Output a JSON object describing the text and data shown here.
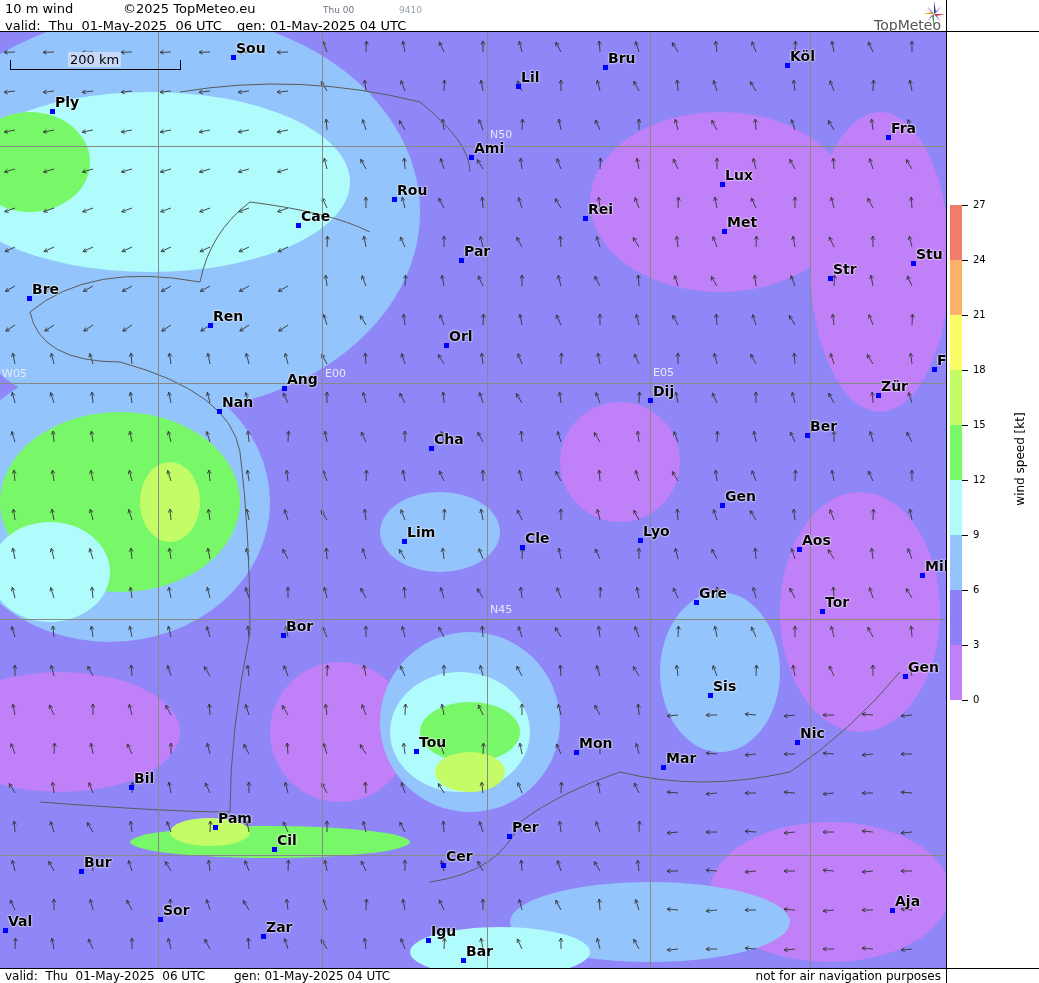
{
  "header": {
    "title": "10 m wind",
    "copyright": "©2025 TopMeteo.eu",
    "run_label": "Thu 00",
    "code": "9410",
    "valid": "valid:  Thu  01-May-2025  06 UTC",
    "generated": "gen: 01-May-2025 04 UTC",
    "logo": "TopMeteo"
  },
  "map": {
    "scale_bar": "200 km",
    "grid_labels": [
      "N50",
      "W05",
      "E00",
      "E05",
      "N45"
    ],
    "cities": [
      "Sou",
      "Ply",
      "Lil",
      "Bru",
      "Köl",
      "Ami",
      "Fra",
      "Lux",
      "Rou",
      "Cae",
      "Rei",
      "Met",
      "Par",
      "Stu",
      "Str",
      "Bre",
      "Ren",
      "Orl",
      "F",
      "Ang",
      "Nan",
      "Dij",
      "Zür",
      "Ber",
      "Cha",
      "Gen",
      "Lim",
      "Cle",
      "Lyo",
      "Aos",
      "Mil",
      "Gre",
      "Tor",
      "Bor",
      "Gen",
      "Sis",
      "Nic",
      "Tou",
      "Mon",
      "Mar",
      "Bil",
      "Per",
      "Pam",
      "Cil",
      "Cer",
      "Bur",
      "Aja",
      "Sor",
      "Val",
      "Zar",
      "Igu",
      "Bar"
    ]
  },
  "legend": {
    "title": "wind speed [kt]",
    "bands": [
      {
        "color": "#f07c6c"
      },
      {
        "color": "#fcb068"
      },
      {
        "color": "#fcfc68"
      },
      {
        "color": "#c4fc68"
      },
      {
        "color": "#78f868"
      },
      {
        "color": "#b0fcfc"
      },
      {
        "color": "#94c4fc"
      },
      {
        "color": "#8f80f8"
      },
      {
        "color": "#c080f8"
      }
    ],
    "ticks": [
      "27",
      "24",
      "21",
      "18",
      "15",
      "12",
      "9",
      "6",
      "3",
      "0"
    ]
  },
  "footer": {
    "valid": "valid:  Thu  01-May-2025  06 UTC",
    "generated": "gen: 01-May-2025 04 UTC",
    "disclaimer": "not for air navigation purposes"
  }
}
